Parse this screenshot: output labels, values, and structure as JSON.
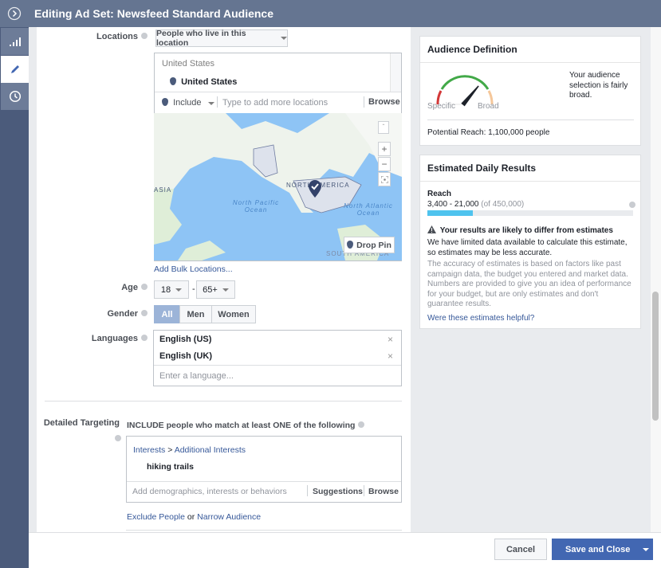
{
  "header": {
    "title": "Editing Ad Set: Newsfeed Standard Audience"
  },
  "rail": {
    "items": [
      {
        "name": "expand",
        "icon": "chevron-right-circle-icon"
      },
      {
        "name": "insights",
        "icon": "bar-chart-icon"
      },
      {
        "name": "edit",
        "icon": "pencil-icon",
        "active": true
      },
      {
        "name": "history",
        "icon": "clock-icon"
      }
    ]
  },
  "locations": {
    "label": "Locations",
    "type_select": "People who live in this location",
    "group_label": "United States",
    "selected": "United States",
    "include_select": "Include",
    "input_placeholder": "Type to add more locations",
    "browse": "Browse",
    "map": {
      "labels": [
        "ASIA",
        "NORTH AMERICA",
        "North Pacific Ocean",
        "North Atlantic Ocean",
        "SOUTH AMERICA"
      ],
      "zoom_in": "+",
      "zoom_out": "−",
      "drop_pin": "Drop Pin"
    },
    "bulk_link": "Add Bulk Locations..."
  },
  "age": {
    "label": "Age",
    "min": "18",
    "separator": "-",
    "max": "65+"
  },
  "gender": {
    "label": "Gender",
    "options": [
      "All",
      "Men",
      "Women"
    ],
    "selected": "All"
  },
  "languages": {
    "label": "Languages",
    "items": [
      "English (US)",
      "English (UK)"
    ],
    "placeholder": "Enter a language..."
  },
  "detailed_targeting": {
    "label": "Detailed Targeting",
    "heading": "INCLUDE people who match at least ONE of the following",
    "path_category": "Interests",
    "path_sep": ">",
    "path_sub": "Additional Interests",
    "item": "hiking trails",
    "placeholder": "Add demographics, interests or behaviors",
    "suggestions": "Suggestions",
    "browse": "Browse",
    "exclude_link": "Exclude People",
    "or_text": "or",
    "narrow_link": "Narrow Audience"
  },
  "audience_definition": {
    "title": "Audience Definition",
    "gauge_specific": "Specific",
    "gauge_broad": "Broad",
    "gauge_level": 0.72,
    "description": "Your audience selection is fairly broad.",
    "potential_reach": "Potential Reach: 1,100,000 people"
  },
  "estimated_results": {
    "title": "Estimated Daily Results",
    "reach_label": "Reach",
    "reach_range": "3,400 - 21,000",
    "reach_of": "(of 450,000)",
    "reach_fraction": 0.22,
    "warning_title": "Your results are likely to differ from estimates",
    "warning_text": "We have limited data available to calculate this estimate, so estimates may be less accurate.",
    "note": "The accuracy of estimates is based on factors like past campaign data, the budget you entered and market data. Numbers are provided to give you an idea of performance for your budget, but are only estimates and don't guarantee results.",
    "helpful_link": "Were these estimates helpful?"
  },
  "footer": {
    "cancel": "Cancel",
    "save": "Save and Close"
  },
  "colors": {
    "header": "#657591",
    "rail": "#4b5b7b",
    "primary": "#4267b2",
    "link": "#365899",
    "reach_bar": "#4fc3ee",
    "gauge_green": "#42a948",
    "gauge_red": "#d33838",
    "gauge_orange": "#f5c79a"
  }
}
